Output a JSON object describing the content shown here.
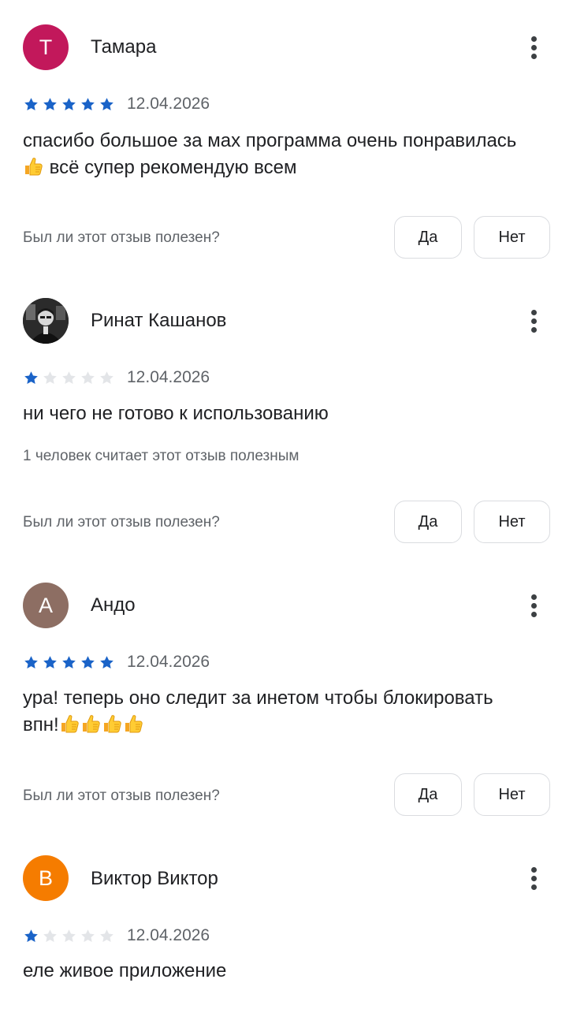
{
  "colors": {
    "star_filled": "#1a63c8",
    "star_empty": "#e3e5e8",
    "avatar_tamara": "#c2185b",
    "avatar_ando": "#8d6e63",
    "avatar_viktor": "#f57c00"
  },
  "reviews": [
    {
      "author": "Тамара",
      "avatar_letter": "Т",
      "rating": 5,
      "date": "12.04.2026",
      "text_line1": "спасибо большое за мах программа очень понравилась",
      "text_line2": "всё супер рекомендую всем",
      "question": "Был ли этот отзыв полезен?",
      "yes_label": "Да",
      "no_label": "Нет"
    },
    {
      "author": "Ринат Кашанов",
      "avatar_letter": "",
      "rating": 1,
      "date": "12.04.2026",
      "text_line1": "ни чего не готово к использованию",
      "helpful_count": "1 человек считает этот отзыв полезным",
      "question": "Был ли этот отзыв полезен?",
      "yes_label": "Да",
      "no_label": "Нет"
    },
    {
      "author": "Андо",
      "avatar_letter": "А",
      "rating": 5,
      "date": "12.04.2026",
      "text_line1": "ура! теперь оно следит за инетом чтобы блокировать",
      "text_line2": "впн!",
      "question": "Был ли этот отзыв полезен?",
      "yes_label": "Да",
      "no_label": "Нет"
    },
    {
      "author": "Виктор Виктор",
      "avatar_letter": "В",
      "rating": 1,
      "date": "12.04.2026",
      "text_line1": "еле живое приложение"
    }
  ]
}
